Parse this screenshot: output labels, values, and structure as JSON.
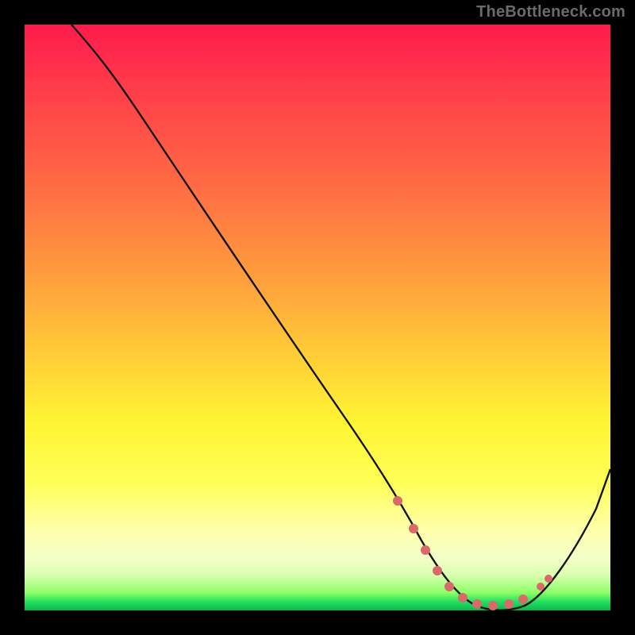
{
  "attribution": "TheBottleneck.com",
  "chart_data": {
    "type": "line",
    "title": "",
    "xlabel": "",
    "ylabel": "",
    "xlim": [
      0,
      100
    ],
    "ylim": [
      0,
      100
    ],
    "series": [
      {
        "name": "curve",
        "x": [
          8,
          12,
          18,
          25,
          33,
          42,
          50,
          58,
          63,
          67,
          70,
          73,
          76,
          79,
          82,
          85,
          88,
          92,
          96,
          100
        ],
        "y": [
          100,
          96,
          89,
          80,
          69,
          57,
          46,
          34,
          26,
          19,
          13,
          8,
          5,
          3,
          2,
          2,
          4,
          10,
          18,
          27
        ]
      }
    ],
    "markers": {
      "name": "highlighted-points",
      "color": "#d86a6a",
      "x": [
        63,
        67,
        70,
        73,
        76,
        79,
        82,
        85,
        88
      ],
      "y": [
        26,
        19,
        13,
        8,
        5,
        3,
        2,
        2,
        4
      ]
    },
    "background_gradient": {
      "stops": [
        {
          "pos": 0,
          "color": "#ff1a4d"
        },
        {
          "pos": 0.55,
          "color": "#ffc838"
        },
        {
          "pos": 0.86,
          "color": "#ffffa8"
        },
        {
          "pos": 1.0,
          "color": "#0ab84c"
        }
      ]
    }
  }
}
